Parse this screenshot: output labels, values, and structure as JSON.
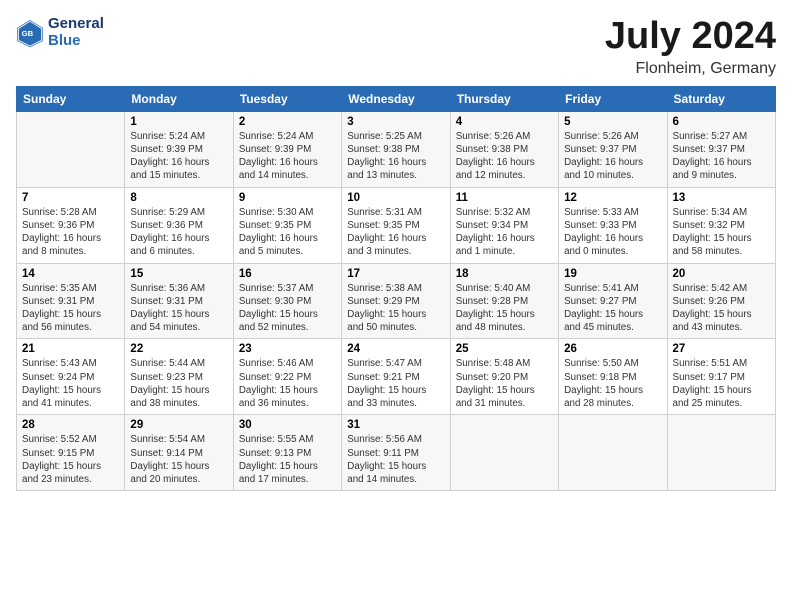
{
  "header": {
    "logo_line1": "General",
    "logo_line2": "Blue",
    "title": "July 2024",
    "subtitle": "Flonheim, Germany"
  },
  "days_of_week": [
    "Sunday",
    "Monday",
    "Tuesday",
    "Wednesday",
    "Thursday",
    "Friday",
    "Saturday"
  ],
  "weeks": [
    [
      {
        "day": "",
        "info": ""
      },
      {
        "day": "1",
        "info": "Sunrise: 5:24 AM\nSunset: 9:39 PM\nDaylight: 16 hours\nand 15 minutes."
      },
      {
        "day": "2",
        "info": "Sunrise: 5:24 AM\nSunset: 9:39 PM\nDaylight: 16 hours\nand 14 minutes."
      },
      {
        "day": "3",
        "info": "Sunrise: 5:25 AM\nSunset: 9:38 PM\nDaylight: 16 hours\nand 13 minutes."
      },
      {
        "day": "4",
        "info": "Sunrise: 5:26 AM\nSunset: 9:38 PM\nDaylight: 16 hours\nand 12 minutes."
      },
      {
        "day": "5",
        "info": "Sunrise: 5:26 AM\nSunset: 9:37 PM\nDaylight: 16 hours\nand 10 minutes."
      },
      {
        "day": "6",
        "info": "Sunrise: 5:27 AM\nSunset: 9:37 PM\nDaylight: 16 hours\nand 9 minutes."
      }
    ],
    [
      {
        "day": "7",
        "info": "Sunrise: 5:28 AM\nSunset: 9:36 PM\nDaylight: 16 hours\nand 8 minutes."
      },
      {
        "day": "8",
        "info": "Sunrise: 5:29 AM\nSunset: 9:36 PM\nDaylight: 16 hours\nand 6 minutes."
      },
      {
        "day": "9",
        "info": "Sunrise: 5:30 AM\nSunset: 9:35 PM\nDaylight: 16 hours\nand 5 minutes."
      },
      {
        "day": "10",
        "info": "Sunrise: 5:31 AM\nSunset: 9:35 PM\nDaylight: 16 hours\nand 3 minutes."
      },
      {
        "day": "11",
        "info": "Sunrise: 5:32 AM\nSunset: 9:34 PM\nDaylight: 16 hours\nand 1 minute."
      },
      {
        "day": "12",
        "info": "Sunrise: 5:33 AM\nSunset: 9:33 PM\nDaylight: 16 hours\nand 0 minutes."
      },
      {
        "day": "13",
        "info": "Sunrise: 5:34 AM\nSunset: 9:32 PM\nDaylight: 15 hours\nand 58 minutes."
      }
    ],
    [
      {
        "day": "14",
        "info": "Sunrise: 5:35 AM\nSunset: 9:31 PM\nDaylight: 15 hours\nand 56 minutes."
      },
      {
        "day": "15",
        "info": "Sunrise: 5:36 AM\nSunset: 9:31 PM\nDaylight: 15 hours\nand 54 minutes."
      },
      {
        "day": "16",
        "info": "Sunrise: 5:37 AM\nSunset: 9:30 PM\nDaylight: 15 hours\nand 52 minutes."
      },
      {
        "day": "17",
        "info": "Sunrise: 5:38 AM\nSunset: 9:29 PM\nDaylight: 15 hours\nand 50 minutes."
      },
      {
        "day": "18",
        "info": "Sunrise: 5:40 AM\nSunset: 9:28 PM\nDaylight: 15 hours\nand 48 minutes."
      },
      {
        "day": "19",
        "info": "Sunrise: 5:41 AM\nSunset: 9:27 PM\nDaylight: 15 hours\nand 45 minutes."
      },
      {
        "day": "20",
        "info": "Sunrise: 5:42 AM\nSunset: 9:26 PM\nDaylight: 15 hours\nand 43 minutes."
      }
    ],
    [
      {
        "day": "21",
        "info": "Sunrise: 5:43 AM\nSunset: 9:24 PM\nDaylight: 15 hours\nand 41 minutes."
      },
      {
        "day": "22",
        "info": "Sunrise: 5:44 AM\nSunset: 9:23 PM\nDaylight: 15 hours\nand 38 minutes."
      },
      {
        "day": "23",
        "info": "Sunrise: 5:46 AM\nSunset: 9:22 PM\nDaylight: 15 hours\nand 36 minutes."
      },
      {
        "day": "24",
        "info": "Sunrise: 5:47 AM\nSunset: 9:21 PM\nDaylight: 15 hours\nand 33 minutes."
      },
      {
        "day": "25",
        "info": "Sunrise: 5:48 AM\nSunset: 9:20 PM\nDaylight: 15 hours\nand 31 minutes."
      },
      {
        "day": "26",
        "info": "Sunrise: 5:50 AM\nSunset: 9:18 PM\nDaylight: 15 hours\nand 28 minutes."
      },
      {
        "day": "27",
        "info": "Sunrise: 5:51 AM\nSunset: 9:17 PM\nDaylight: 15 hours\nand 25 minutes."
      }
    ],
    [
      {
        "day": "28",
        "info": "Sunrise: 5:52 AM\nSunset: 9:15 PM\nDaylight: 15 hours\nand 23 minutes."
      },
      {
        "day": "29",
        "info": "Sunrise: 5:54 AM\nSunset: 9:14 PM\nDaylight: 15 hours\nand 20 minutes."
      },
      {
        "day": "30",
        "info": "Sunrise: 5:55 AM\nSunset: 9:13 PM\nDaylight: 15 hours\nand 17 minutes."
      },
      {
        "day": "31",
        "info": "Sunrise: 5:56 AM\nSunset: 9:11 PM\nDaylight: 15 hours\nand 14 minutes."
      },
      {
        "day": "",
        "info": ""
      },
      {
        "day": "",
        "info": ""
      },
      {
        "day": "",
        "info": ""
      }
    ]
  ]
}
